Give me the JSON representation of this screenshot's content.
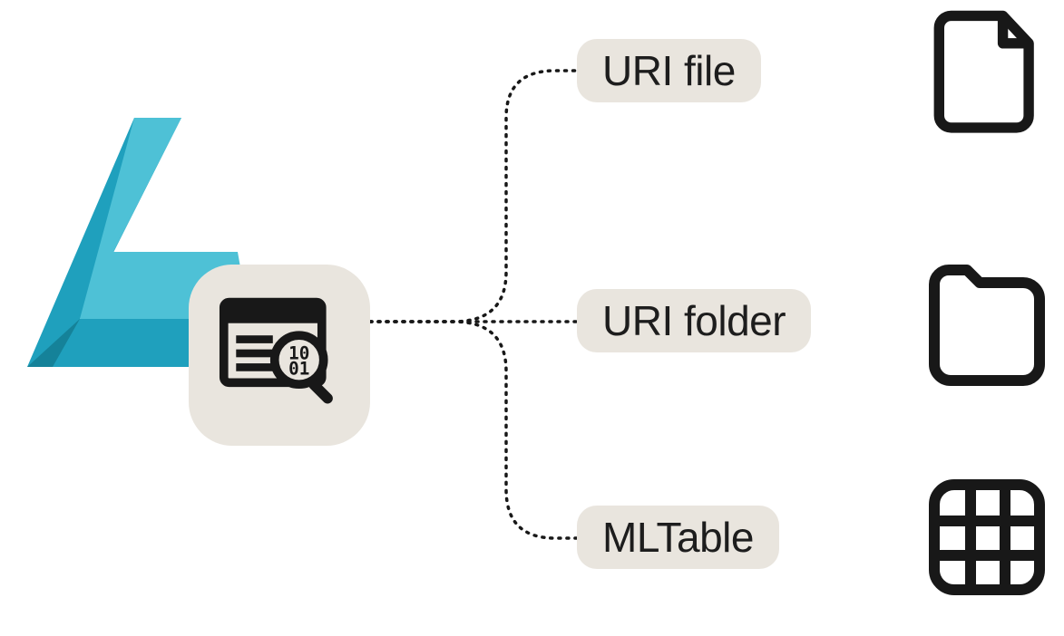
{
  "diagram": {
    "source": {
      "logo_name": "azure-ml-logo",
      "data_asset_name": "data-asset"
    },
    "targets": [
      {
        "label": "URI file",
        "icon": "file-icon"
      },
      {
        "label": "URI folder",
        "icon": "folder-icon"
      },
      {
        "label": "MLTable",
        "icon": "table-icon"
      }
    ],
    "colors": {
      "pill_bg": "#e9e5de",
      "stroke": "#181818",
      "azure_light": "#5bc4d8",
      "azure_dark": "#1a9fb8"
    }
  }
}
